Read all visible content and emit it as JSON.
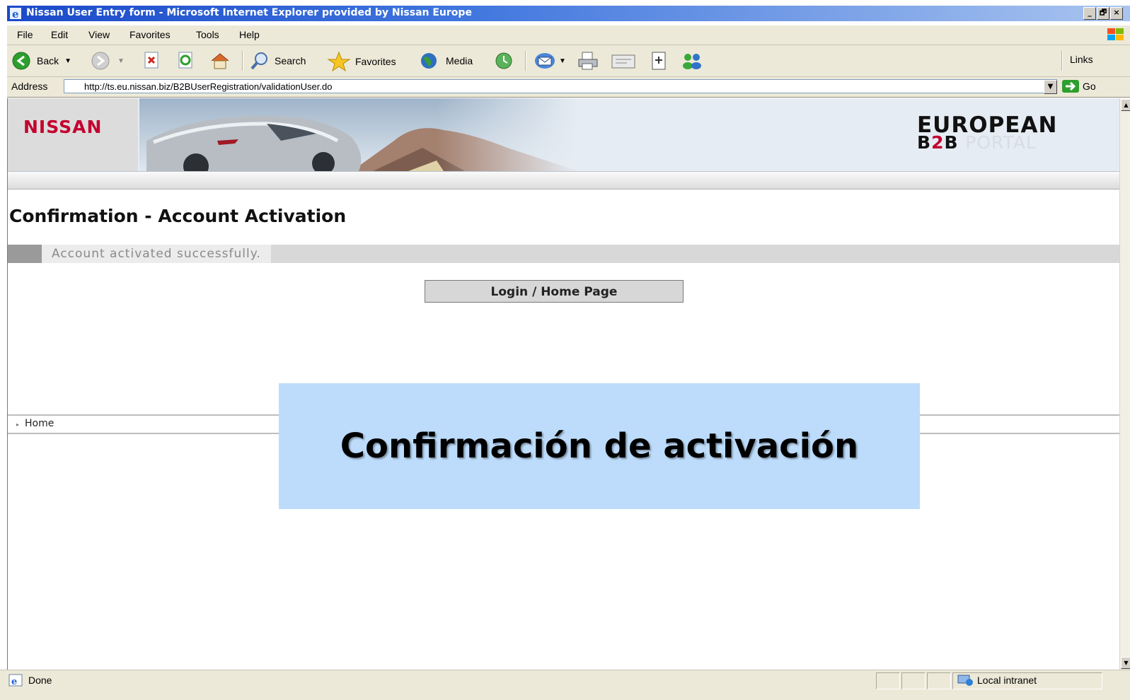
{
  "window": {
    "title": "Nissan User Entry form - Microsoft Internet Explorer provided by Nissan Europe",
    "controls": [
      "_",
      "🗗",
      "×"
    ]
  },
  "menu": {
    "items": [
      {
        "label": "File",
        "accel": "F"
      },
      {
        "label": "Edit",
        "accel": "E"
      },
      {
        "label": "View",
        "accel": "V"
      },
      {
        "label": "Favorites",
        "accel": "a"
      },
      {
        "label": "Tools",
        "accel": "T"
      },
      {
        "label": "Help",
        "accel": "H"
      }
    ]
  },
  "toolbar": {
    "back_label": "Back",
    "search_label": "Search",
    "favorites_label": "Favorites",
    "media_label": "Media",
    "links_label": "Links"
  },
  "address": {
    "label": "Address",
    "url": "http://ts.eu.nissan.biz/B2BUserRegistration/validationUser.do",
    "go_label": "Go"
  },
  "banner": {
    "logo": "NISSAN",
    "portal_line1": "EUROPEAN",
    "portal_b": "B",
    "portal_2": "2",
    "portal_b2": "B",
    "portal_word": "PORTAL"
  },
  "page": {
    "title": "Confirmation - Account Activation",
    "message": "Account activated successfully.",
    "login_button": "Login / Home Page",
    "footer_nav": "Home"
  },
  "overlay": {
    "text": "Confirmación de activación"
  },
  "status": {
    "text": "Done",
    "zone": "Local intranet"
  },
  "colors": {
    "nissan_red": "#c3002f",
    "titlebar_blue": "#1b49c9",
    "overlay_bg": "#bddcfb"
  }
}
